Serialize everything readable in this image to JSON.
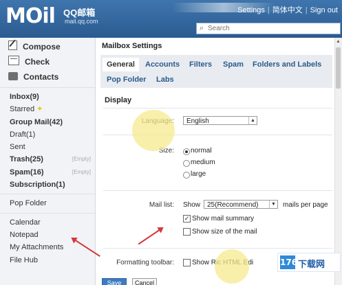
{
  "header": {
    "logo_text": "MOil",
    "logo_sub": "QQ邮箱",
    "logo_url": "mail.qq.com",
    "links": [
      "Settings",
      "简体中文",
      "Sign out"
    ],
    "search_placeholder": "Search"
  },
  "sidebar": {
    "actions": [
      "Compose",
      "Check",
      "Contacts"
    ],
    "folders": [
      {
        "label": "Inbox(9)",
        "bold": true
      },
      {
        "label": "Starred",
        "bold": false
      },
      {
        "label": "Group Mail(42)",
        "bold": true
      },
      {
        "label": "Draft(1)",
        "bold": false
      },
      {
        "label": "Sent",
        "bold": false
      },
      {
        "label": "Trash(25)",
        "bold": true,
        "empty": "[Empty]"
      },
      {
        "label": "Spam(16)",
        "bold": true,
        "empty": "[Empty]"
      },
      {
        "label": "Subscription(1)",
        "bold": true
      }
    ],
    "pop": "Pop Folder",
    "tools": [
      "Calendar",
      "Notepad",
      "My Attachments",
      "File Hub"
    ]
  },
  "main": {
    "title": "Mailbox Settings",
    "tabs": [
      "General",
      "Accounts",
      "Filters",
      "Spam",
      "Folders and Labels",
      "Pop Folder",
      "Labs"
    ],
    "active_tab": "General",
    "section": "Display",
    "language_label": "Language:",
    "language_value": "English",
    "size_label": "Size:",
    "size_options": [
      "normal",
      "medium",
      "large"
    ],
    "size_selected": "normal",
    "maillist_label": "Mail list:",
    "show_label": "Show",
    "show_value": "25(Recommend)",
    "per_page": "mails per page",
    "show_summary": "Show mail summary",
    "show_summary_checked": true,
    "show_size": "Show size of the mail",
    "show_size_checked": false,
    "formatting_label": "Formatting toolbar:",
    "formatting_value": "Show Ric      HTML Edi",
    "save": "Save",
    "cancel": "Cancel"
  },
  "watermark": {
    "box": "176",
    "text": "下载网"
  },
  "colors": {
    "header": "#2f639b",
    "tab_link": "#2b5a8a",
    "arrow": "#d23a3a",
    "save": "#3f7bc1"
  }
}
